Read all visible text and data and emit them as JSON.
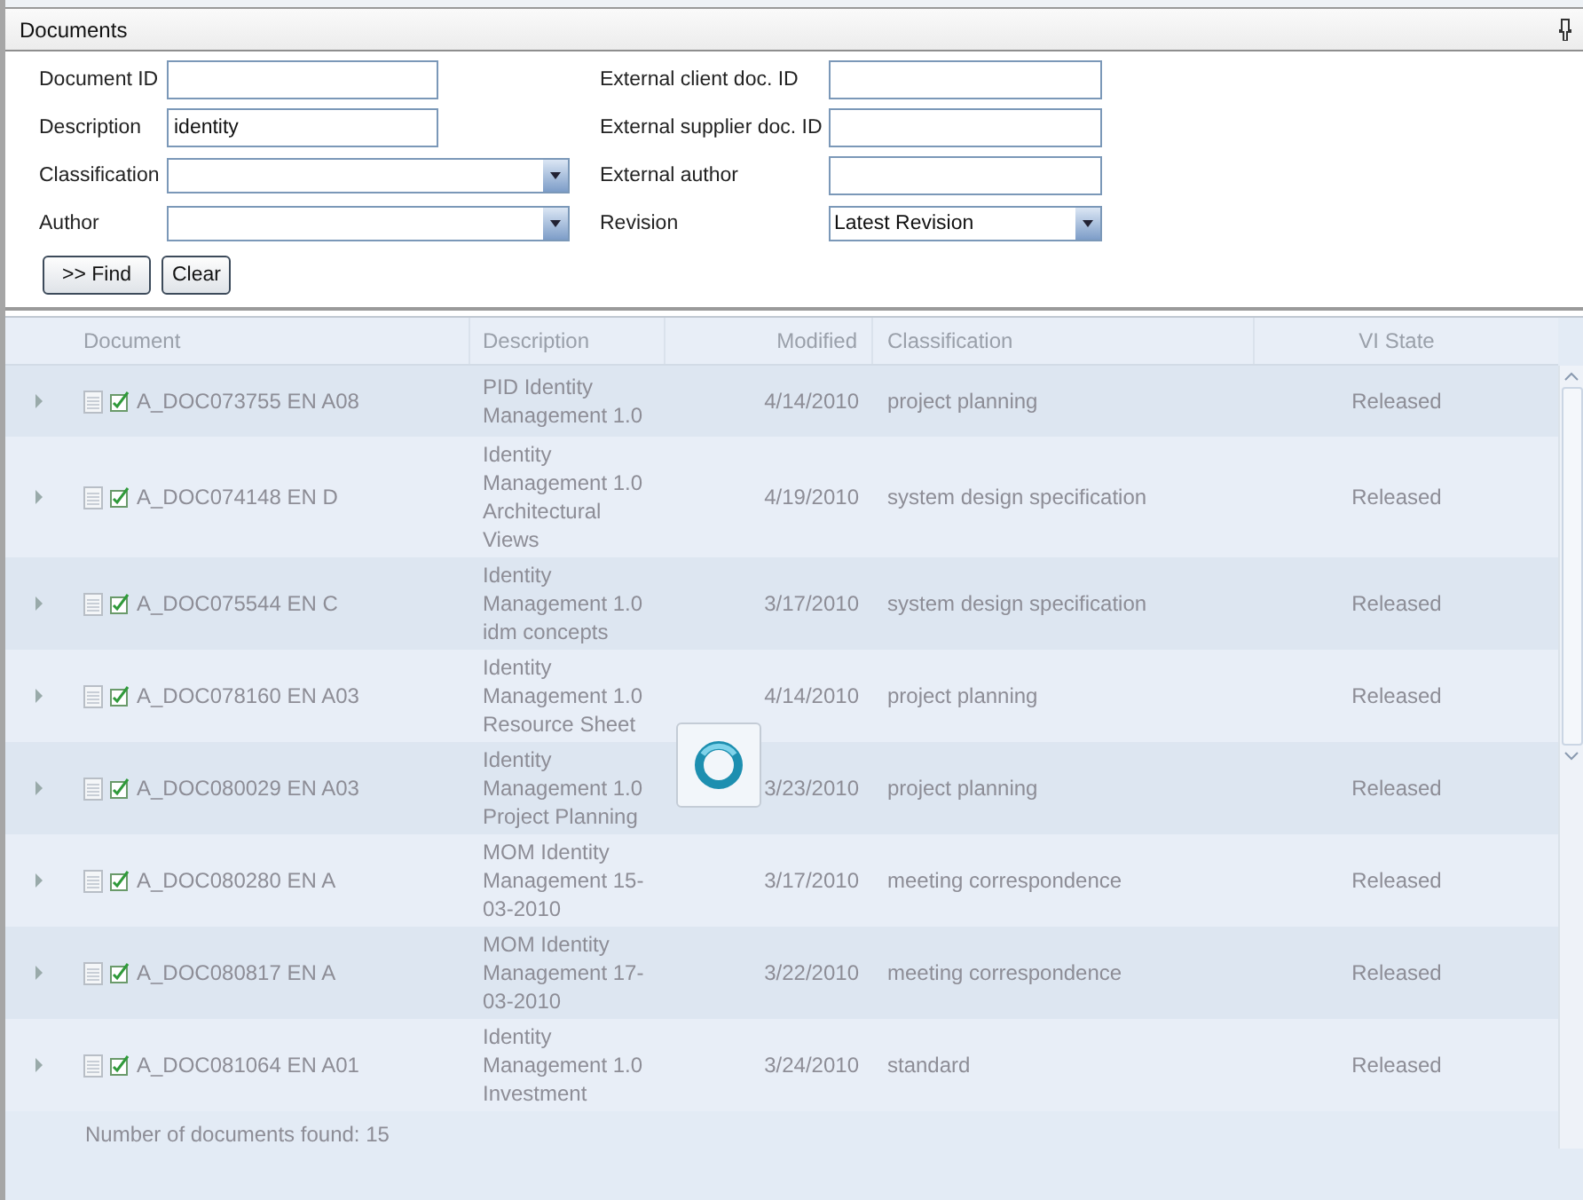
{
  "panel": {
    "title": "Documents"
  },
  "search_form": {
    "left_fields": [
      {
        "label": "Document ID",
        "kind": "text"
      },
      {
        "label": "Description",
        "kind": "text",
        "value": "identity"
      },
      {
        "label": "Classification",
        "kind": "combo"
      },
      {
        "label": "Author",
        "kind": "combo"
      }
    ],
    "right_fields": [
      {
        "label": "External client doc. ID",
        "kind": "text"
      },
      {
        "label": "External supplier doc. ID",
        "kind": "text"
      },
      {
        "label": "External author",
        "kind": "text"
      },
      {
        "label": "Revision",
        "kind": "combo",
        "value": "Latest Revision"
      }
    ],
    "buttons": [
      ">> Find",
      "Clear"
    ]
  },
  "grid": {
    "disabled": true,
    "loading": true,
    "columns": [
      "Document",
      "Description",
      "Modified",
      "Classification",
      "VI State"
    ],
    "rows": [
      {
        "document": "A_DOC073755 EN A08",
        "description": "PID Identity Management 1.0",
        "modified": "4/14/2010",
        "classification": "project planning",
        "vi_state": "Released"
      },
      {
        "document": "A_DOC074148 EN D",
        "description": "Identity Management 1.0 Architectural Views",
        "modified": "4/19/2010",
        "classification": "system design specification",
        "vi_state": "Released"
      },
      {
        "document": "A_DOC075544 EN C",
        "description": "Identity Management 1.0 idm concepts",
        "modified": "3/17/2010",
        "classification": "system design specification",
        "vi_state": "Released"
      },
      {
        "document": "A_DOC078160 EN A03",
        "description": "Identity Management 1.0 Resource Sheet",
        "modified": "4/14/2010",
        "classification": "project planning",
        "vi_state": "Released"
      },
      {
        "document": "A_DOC080029 EN A03",
        "description": "Identity Management 1.0 Project Planning",
        "modified": "3/23/2010",
        "classification": "project planning",
        "vi_state": "Released"
      },
      {
        "document": "A_DOC080280 EN A",
        "description": "MOM Identity Management 15-03-2010",
        "modified": "3/17/2010",
        "classification": "meeting correspondence",
        "vi_state": "Released"
      },
      {
        "document": "A_DOC080817 EN A",
        "description": "MOM Identity Management 17-03-2010",
        "modified": "3/22/2010",
        "classification": "meeting correspondence",
        "vi_state": "Released"
      },
      {
        "document": "A_DOC081064 EN A01",
        "description": "Identity Management 1.0 Investment",
        "modified": "3/24/2010",
        "classification": "standard",
        "vi_state": "Released"
      }
    ],
    "footer": "Number of documents found: 15"
  }
}
